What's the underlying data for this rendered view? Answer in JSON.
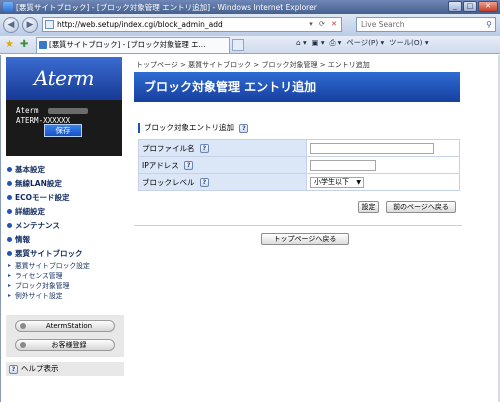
{
  "window": {
    "title": "[悪質サイトブロック] - [ブロック対象管理 エントリ追加] - Windows Internet Explorer",
    "minimize": "_",
    "maximize": "□",
    "close": "✕"
  },
  "navbar": {
    "back_icon": "back-arrow-icon",
    "forward_icon": "forward-arrow-icon",
    "back_glyph": "◀",
    "forward_glyph": "▶",
    "url": "http://web.setup/index.cgi/block_admin_add",
    "search_placeholder": "Live Search",
    "search_glyph": "⚲"
  },
  "tabbar": {
    "tab_title": "[悪質サイトブロック] - [ブロック対象管理 エ...",
    "commands": [
      "⌂ ▾",
      "▣ ▾",
      "⎙ ▾",
      "ページ(P) ▾",
      "ツール(O) ▾"
    ]
  },
  "sidebar": {
    "logo": "Aterm",
    "model_line1": "Aterm",
    "model_line2": "ATERM-XXXXXX",
    "save_label": "保存",
    "menu": [
      "基本設定",
      "無線LAN設定",
      "ECOモード設定",
      "詳細設定",
      "メンテナンス",
      "情報",
      "悪質サイトブロック"
    ],
    "submenu": [
      "悪質サイトブロック設定",
      "ライセンス管理",
      "ブロック対象管理",
      "例外サイト設定"
    ],
    "aterm_station": "AtermStation",
    "customer_reg": "お客様登録",
    "help": "ヘルプ表示"
  },
  "main": {
    "breadcrumb": "トップページ > 悪質サイトブロック > ブロック対象管理 > エントリ追加",
    "title": "ブロック対象管理 エントリ追加",
    "section": "ブロック対象エントリ追加",
    "help_glyph": "?",
    "fields": [
      {
        "label": "プロファイル名",
        "value": ""
      },
      {
        "label": "IPアドレス",
        "value": ""
      },
      {
        "label": "ブロックレベル",
        "value": "小学生以下"
      }
    ],
    "set_button": "設定",
    "back_button": "前のページへ戻る",
    "top_button": "トップページへ戻る"
  },
  "colors": {
    "title_blue": "#1f4fb5",
    "label_bg": "#dbe6f7",
    "sidebar_panel": "#e8e8e8"
  }
}
